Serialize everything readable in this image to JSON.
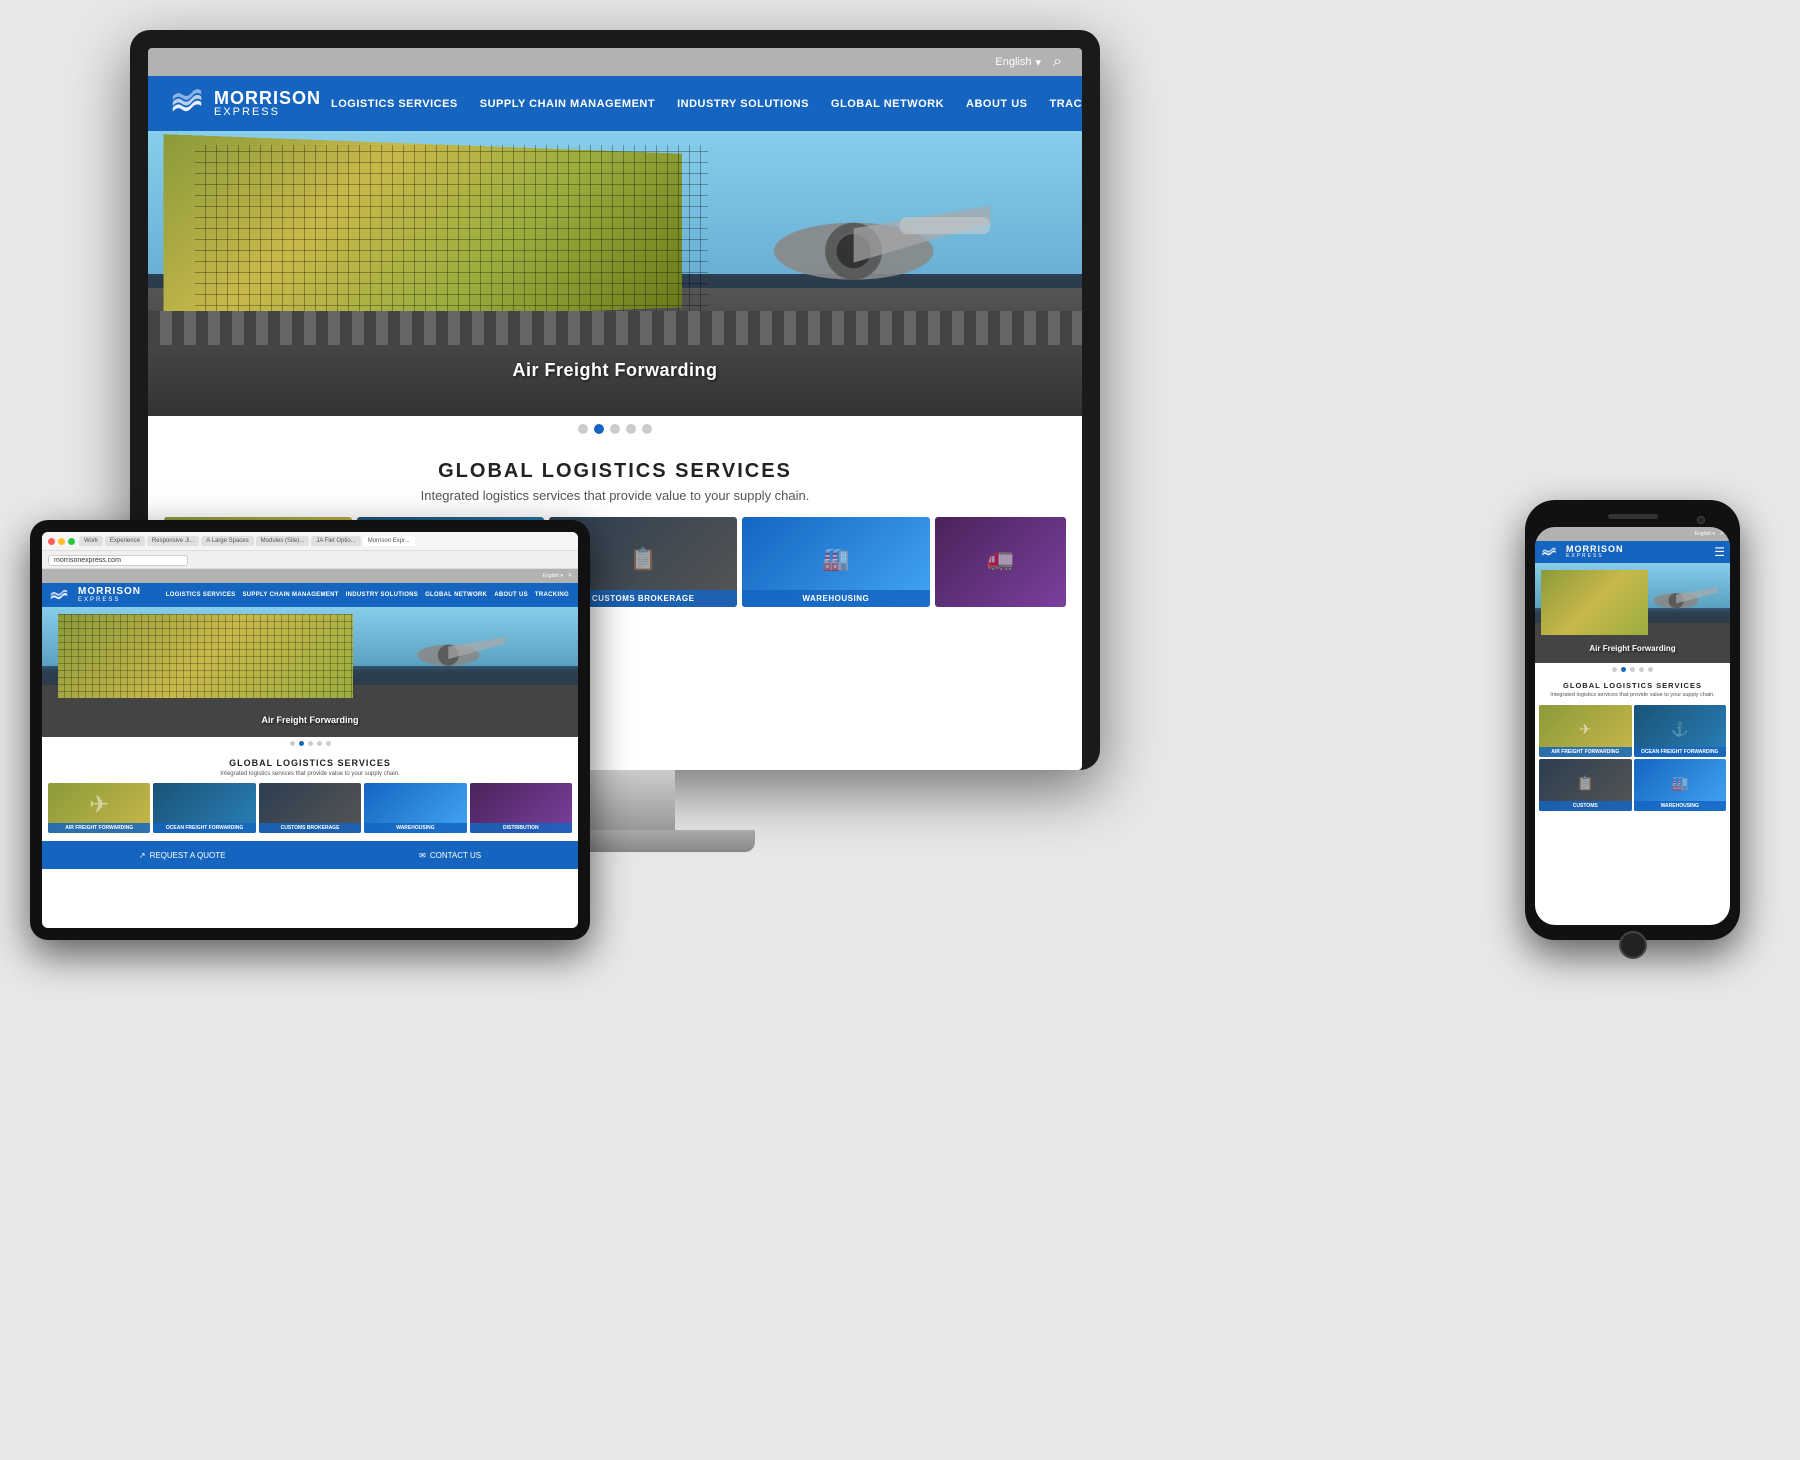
{
  "page": {
    "bg_color": "#e0e0e0"
  },
  "monitor": {
    "type": "desktop"
  },
  "tablet": {
    "type": "tablet",
    "browser": {
      "url": "morrisonexpress.com",
      "tabs": [
        "Work",
        "Experience",
        "Responsive Ji...",
        "A Large Spaces",
        "Modules (Site)...",
        "JA Flet Optio...",
        "Morrison Expr..."
      ]
    }
  },
  "phone": {
    "type": "mobile"
  },
  "website": {
    "brand": {
      "name": "MORRISON",
      "tagline": "EXPRESS",
      "logo_alt": "Morrison Express Logo"
    },
    "header": {
      "lang": "English",
      "lang_arrow": "▾",
      "search_icon": "🔍"
    },
    "nav": {
      "items": [
        "LOGISTICS SERVICES",
        "SUPPLY CHAIN MANAGEMENT",
        "INDUSTRY SOLUTIONS",
        "GLOBAL NETWORK",
        "ABOUT US",
        "TRACKING"
      ]
    },
    "hero": {
      "caption": "Air Freight Forwarding",
      "dots": 5,
      "active_dot": 1
    },
    "services": {
      "title": "GLOBAL LOGISTICS SERVICES",
      "subtitle": "Integrated logistics services that provide value to your supply chain.",
      "cards": [
        {
          "id": "air",
          "label": "AIR FREIGHT FORWARDING",
          "bg": "air"
        },
        {
          "id": "ocean",
          "label": "OCEAN FREIGHT FORWARDING",
          "bg": "ocean"
        },
        {
          "id": "customs",
          "label": "CUSTOMS BROKERAGE",
          "bg": "customs"
        },
        {
          "id": "warehouse",
          "label": "WAREHOUSING",
          "bg": "warehouse"
        },
        {
          "id": "distribution",
          "label": "DISTRIBUTION",
          "bg": "distribution"
        }
      ]
    },
    "footer": {
      "request_quote": "REQUEST A QUOTE",
      "contact_us": "CONTACT US"
    }
  }
}
